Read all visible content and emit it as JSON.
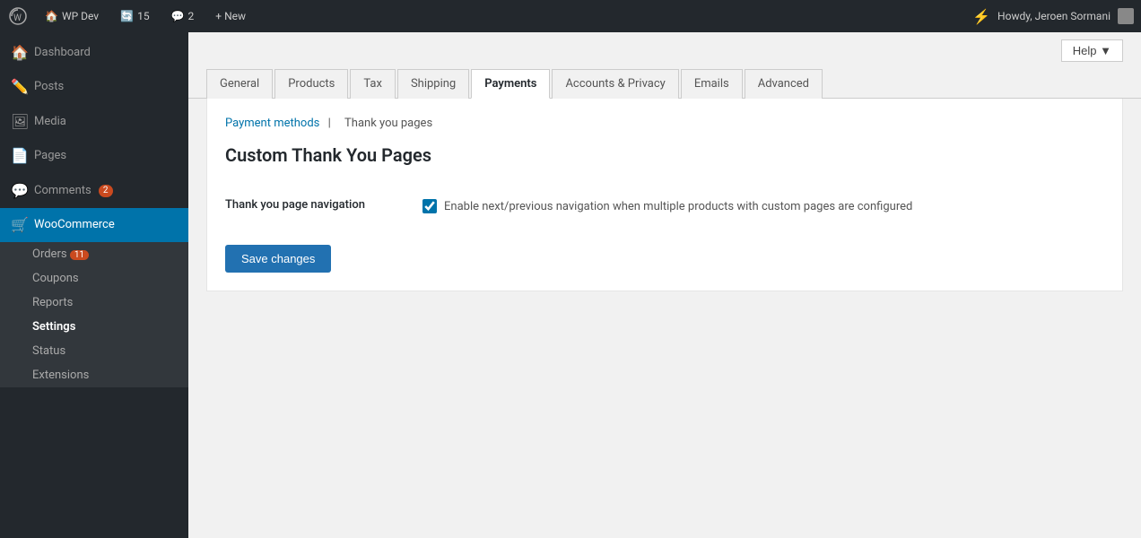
{
  "adminBar": {
    "wpLogoIcon": "wp-logo",
    "siteName": "WP Dev",
    "updateCount": "15",
    "commentCount": "2",
    "newLabel": "+ New",
    "boltIcon": "⚡",
    "userGreeting": "Howdy, Jeroen Sormani"
  },
  "help": {
    "label": "Help ▼"
  },
  "tabs": [
    {
      "label": "General",
      "active": false
    },
    {
      "label": "Products",
      "active": false
    },
    {
      "label": "Tax",
      "active": false
    },
    {
      "label": "Shipping",
      "active": false
    },
    {
      "label": "Payments",
      "active": true
    },
    {
      "label": "Accounts & Privacy",
      "active": false
    },
    {
      "label": "Emails",
      "active": false
    },
    {
      "label": "Advanced",
      "active": false
    }
  ],
  "breadcrumb": {
    "linkText": "Payment methods",
    "separator": "|",
    "currentPage": "Thank you pages"
  },
  "pageTitle": "Custom Thank You Pages",
  "settings": {
    "navigation": {
      "label": "Thank you page navigation",
      "checkboxChecked": true,
      "checkboxText": "Enable next/previous navigation when multiple products with custom pages are configured"
    }
  },
  "saveButton": "Save changes",
  "sidebar": {
    "items": [
      {
        "id": "dashboard",
        "label": "Dashboard",
        "icon": "🏠",
        "active": false
      },
      {
        "id": "posts",
        "label": "Posts",
        "icon": "✏️",
        "active": false
      },
      {
        "id": "media",
        "label": "Media",
        "icon": "🖼",
        "active": false
      },
      {
        "id": "pages",
        "label": "Pages",
        "icon": "📄",
        "active": false
      },
      {
        "id": "comments",
        "label": "Comments",
        "icon": "💬",
        "badge": "2",
        "active": false
      },
      {
        "id": "woocommerce",
        "label": "WooCommerce",
        "icon": "🛒",
        "active": true
      }
    ],
    "wooSubItems": [
      {
        "id": "orders",
        "label": "Orders",
        "badge": "11",
        "active": false
      },
      {
        "id": "coupons",
        "label": "Coupons",
        "active": false
      },
      {
        "id": "reports",
        "label": "Reports",
        "active": false
      },
      {
        "id": "settings",
        "label": "Settings",
        "active": true
      },
      {
        "id": "status",
        "label": "Status",
        "active": false
      },
      {
        "id": "extensions",
        "label": "Extensions",
        "active": false
      }
    ]
  }
}
